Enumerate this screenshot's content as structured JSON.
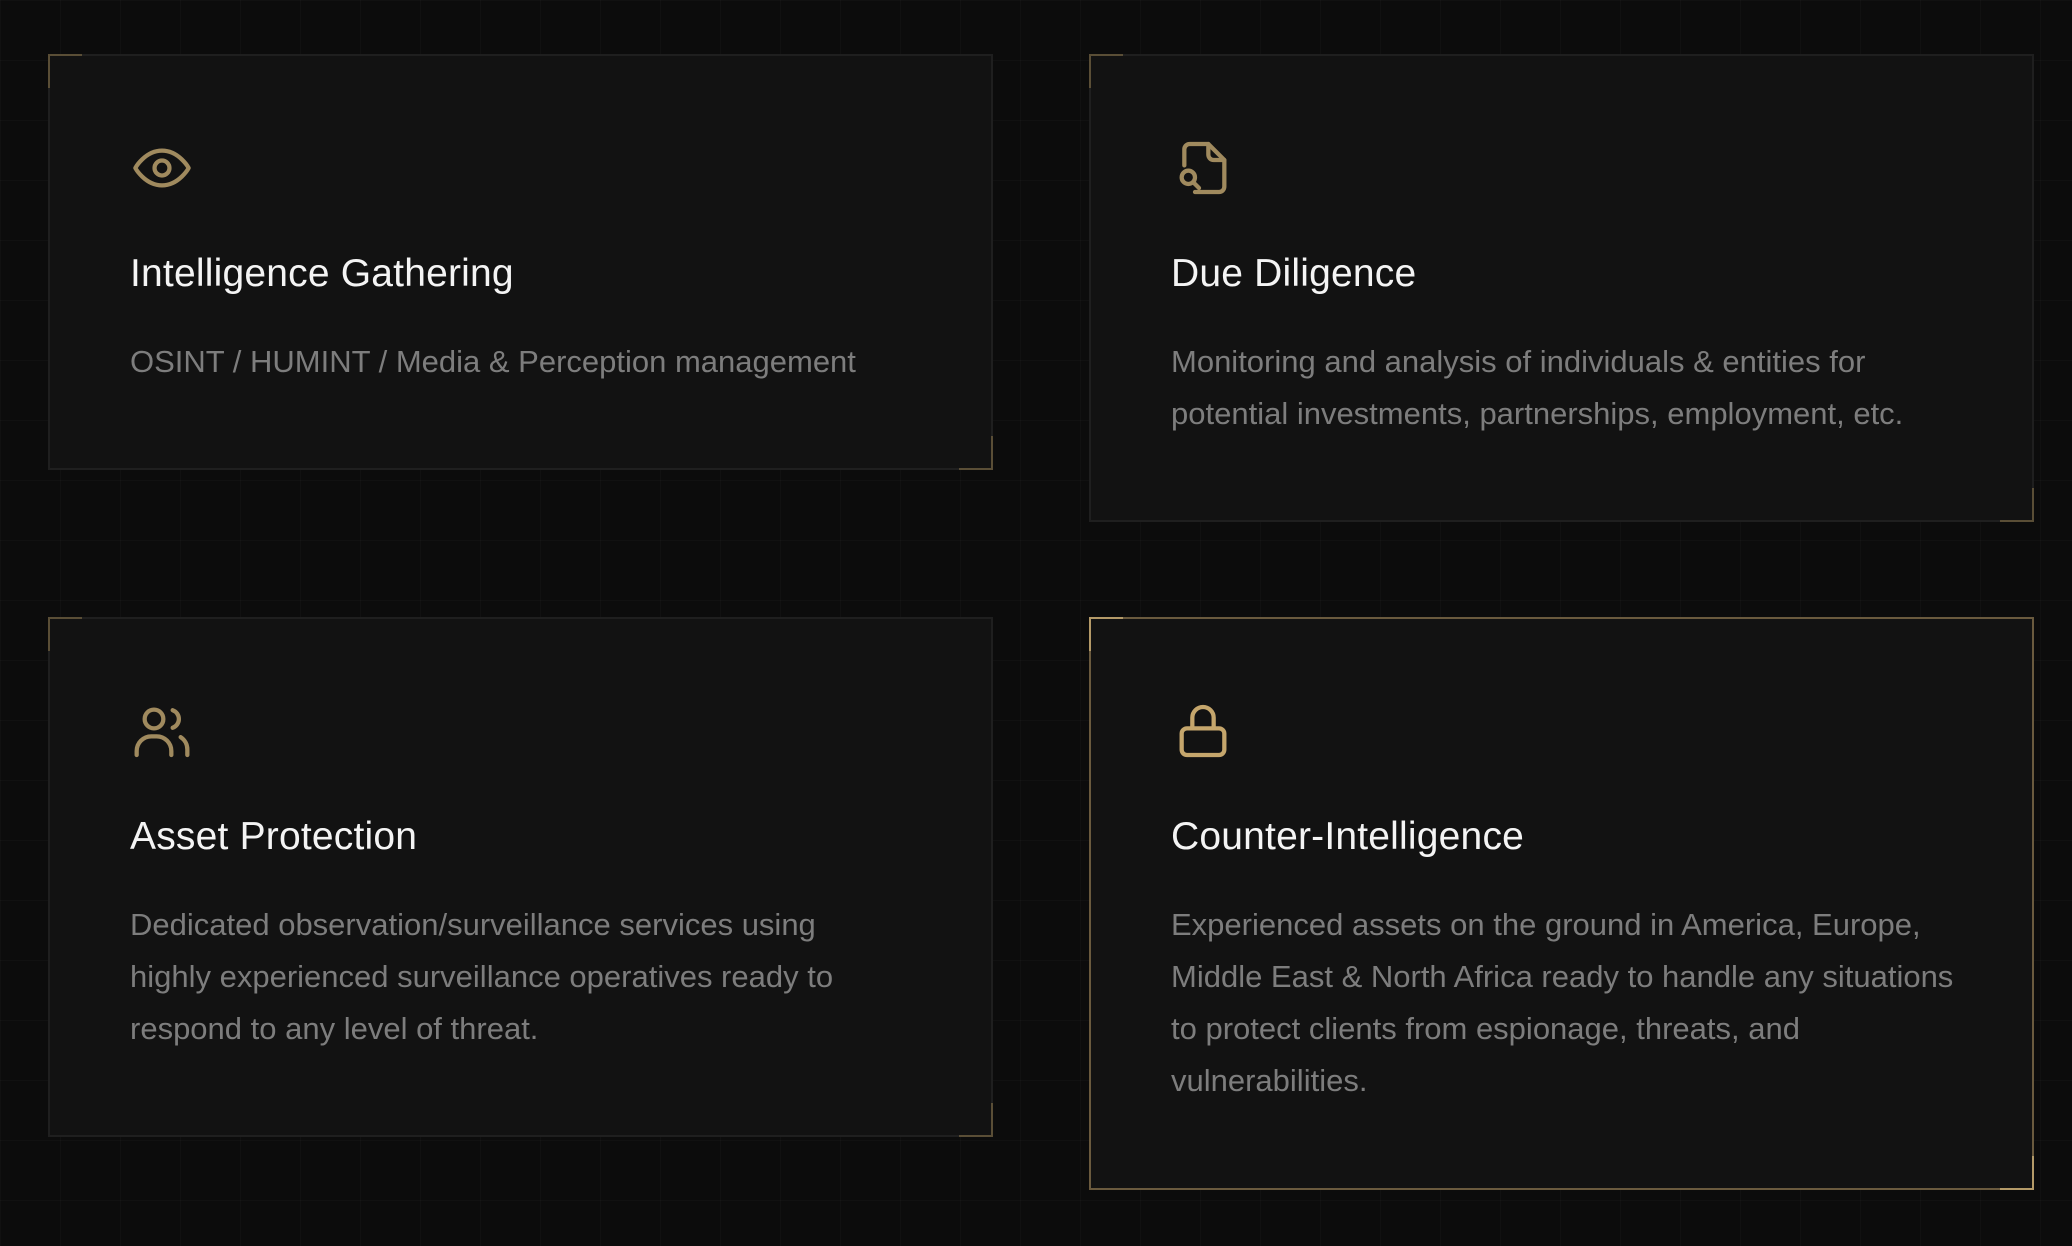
{
  "accent_color": "#b49a68",
  "services": [
    {
      "icon": "eye-icon",
      "title": "Intelligence Gathering",
      "description": "OSINT / HUMINT / Media & Perception management"
    },
    {
      "icon": "file-search-icon",
      "title": "Due Diligence",
      "description": "Monitoring and analysis of individuals & entities for potential investments, partnerships, employment, etc."
    },
    {
      "icon": "users-icon",
      "title": "Asset Protection",
      "description": "Dedicated observation/surveillance services using highly experienced surveillance operatives ready to respond to any level of threat."
    },
    {
      "icon": "lock-icon",
      "title": "Counter-Intelligence",
      "description": "Experienced assets on the ground in America, Europe, Middle East & North Africa ready to handle any situations to protect clients from espionage, threats, and vulnerabilities."
    }
  ]
}
